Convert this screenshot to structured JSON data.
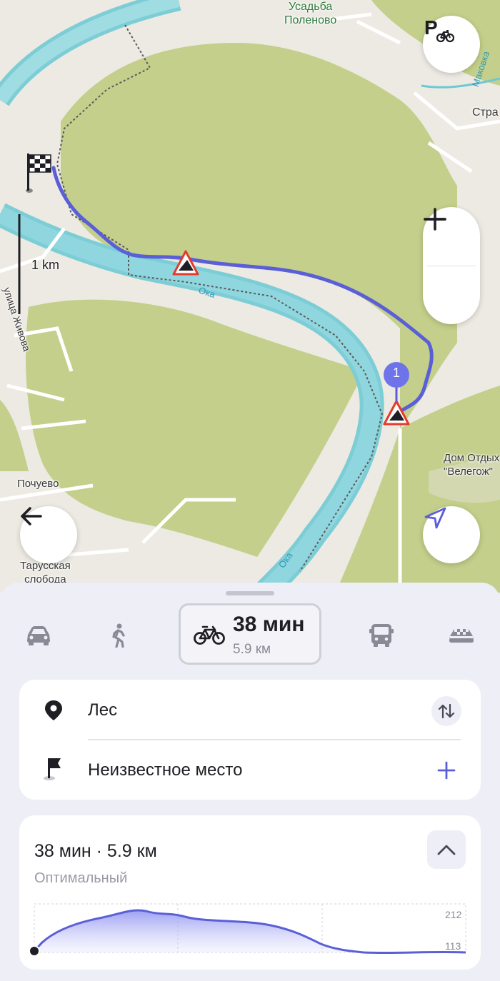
{
  "map": {
    "labels": {
      "usadba": "Усадьба\nПоленово",
      "makovka": "Маковка",
      "stra": "Стра",
      "scale": "1 km",
      "street": "улица Живова",
      "oka1": "Ока",
      "oka2": "Ока",
      "dom": "Дом Отдых\n\"Велегож\"",
      "pochuevo": "Почуево",
      "tarusskaya": "Тарусская\nслобода"
    },
    "waypoint_number": "1",
    "icons": {
      "parking": "bike-parking-icon",
      "finish": "finish-flag-icon",
      "climb": "climb-warning-icon",
      "zoom_in": "plus-icon",
      "zoom_out": "minus-icon",
      "back": "arrow-left-icon",
      "locate": "navigation-arrow-icon"
    },
    "colors": {
      "route": "#5a5fd8",
      "water": "#7ccdd6",
      "forest": "#c3cf8a",
      "land": "#eceae2"
    }
  },
  "sheet": {
    "modes": [
      "car",
      "walk",
      "bike",
      "bus",
      "taxi"
    ],
    "active": {
      "time": "38 мин",
      "distance": "5.9 км"
    },
    "from": {
      "label": "Лес"
    },
    "to": {
      "label": "Неизвестное место"
    },
    "route": {
      "summary": "38 мин · 5.9 км",
      "type": "Оптимальный"
    },
    "elevation": {
      "max_label": "212",
      "min_label": "113"
    }
  }
}
